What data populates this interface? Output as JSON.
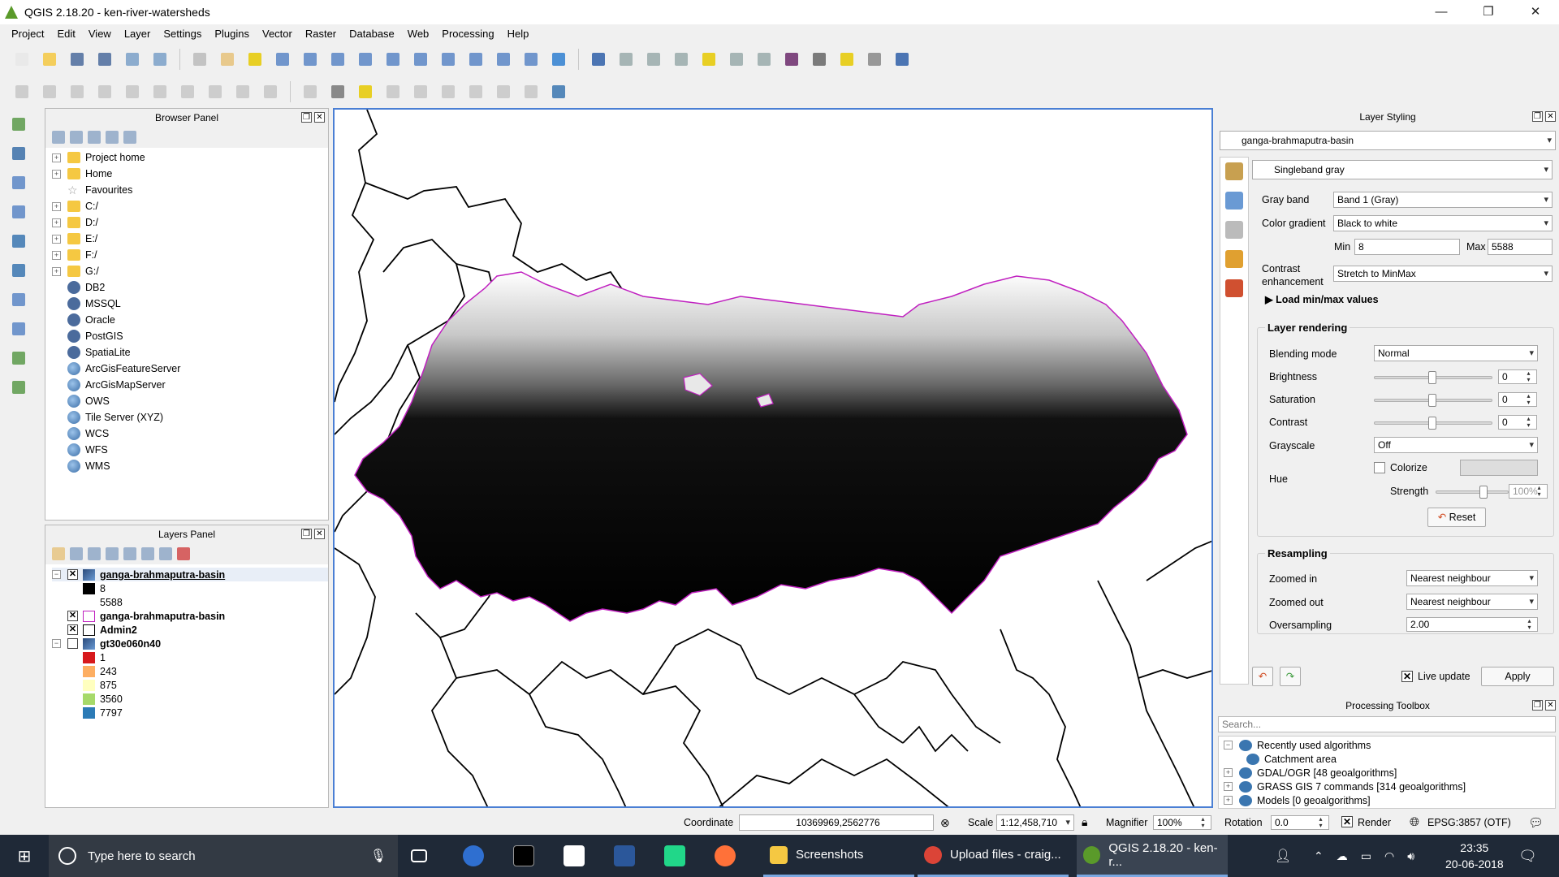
{
  "window": {
    "title": "QGIS 2.18.20 - ken-river-watersheds",
    "min": "—",
    "max": "❐",
    "close": "✕"
  },
  "menu": [
    "Project",
    "Edit",
    "View",
    "Layer",
    "Settings",
    "Plugins",
    "Vector",
    "Raster",
    "Database",
    "Web",
    "Processing",
    "Help"
  ],
  "browser": {
    "title": "Browser Panel",
    "items": [
      {
        "label": "Project home",
        "icon": "folder-icon",
        "exp": true
      },
      {
        "label": "Home",
        "icon": "folder-icon",
        "exp": true
      },
      {
        "label": "Favourites",
        "icon": "star-icon",
        "exp": false
      },
      {
        "label": "C:/",
        "icon": "folder-icon",
        "exp": true
      },
      {
        "label": "D:/",
        "icon": "folder-icon",
        "exp": true
      },
      {
        "label": "E:/",
        "icon": "folder-icon",
        "exp": true
      },
      {
        "label": "F:/",
        "icon": "folder-icon",
        "exp": true
      },
      {
        "label": "G:/",
        "icon": "folder-icon",
        "exp": true
      },
      {
        "label": "DB2",
        "icon": "db2-icon",
        "exp": false
      },
      {
        "label": "MSSQL",
        "icon": "mssql-icon",
        "exp": false
      },
      {
        "label": "Oracle",
        "icon": "oracle-icon",
        "exp": false
      },
      {
        "label": "PostGIS",
        "icon": "postgis-icon",
        "exp": false
      },
      {
        "label": "SpatiaLite",
        "icon": "spatialite-icon",
        "exp": false
      },
      {
        "label": "ArcGisFeatureServer",
        "icon": "globe-icon",
        "exp": false
      },
      {
        "label": "ArcGisMapServer",
        "icon": "globe-icon",
        "exp": false
      },
      {
        "label": "OWS",
        "icon": "globe-icon",
        "exp": false
      },
      {
        "label": "Tile Server (XYZ)",
        "icon": "globe-icon",
        "exp": false
      },
      {
        "label": "WCS",
        "icon": "globe-icon",
        "exp": false
      },
      {
        "label": "WFS",
        "icon": "globe-icon",
        "exp": false
      },
      {
        "label": "WMS",
        "icon": "globe-icon",
        "exp": false
      }
    ]
  },
  "layers": {
    "title": "Layers Panel",
    "l1": {
      "name": "ganga-brahmaputra-basin",
      "min": "8",
      "max": "5588"
    },
    "l2": {
      "name": "ganga-brahmaputra-basin"
    },
    "l3": {
      "name": "Admin2"
    },
    "l4": {
      "name": "gt30e060n40",
      "classes": [
        {
          "label": "1",
          "color": "#d7191c"
        },
        {
          "label": "243",
          "color": "#fdae61"
        },
        {
          "label": "875",
          "color": "#ffffbf"
        },
        {
          "label": "3560",
          "color": "#a6d96a"
        },
        {
          "label": "7797",
          "color": "#2c7bb6"
        }
      ]
    }
  },
  "styling": {
    "title": "Layer Styling",
    "layer": "ganga-brahmaputra-basin",
    "renderer": "Singleband gray",
    "gray_band_label": "Gray band",
    "gray_band": "Band 1 (Gray)",
    "gradient_label": "Color gradient",
    "gradient": "Black to white",
    "min_label": "Min",
    "min": "8",
    "max_label": "Max",
    "max": "5588",
    "contrast_label": "Contrast enhancement",
    "contrast": "Stretch to MinMax",
    "load_minmax": "Load min/max values",
    "rendering_title": "Layer rendering",
    "blending_label": "Blending mode",
    "blending": "Normal",
    "brightness_label": "Brightness",
    "brightness": "0",
    "saturation_label": "Saturation",
    "saturation": "0",
    "contrast2_label": "Contrast",
    "contrast2": "0",
    "grayscale_label": "Grayscale",
    "grayscale": "Off",
    "hue_label": "Hue",
    "colorize_label": "Colorize",
    "strength_label": "Strength",
    "strength": "100%",
    "reset": "Reset",
    "resampling_title": "Resampling",
    "zin_label": "Zoomed in",
    "zin": "Nearest neighbour",
    "zout_label": "Zoomed out",
    "zout": "Nearest neighbour",
    "over_label": "Oversampling",
    "over": "2.00",
    "live_update": "Live update",
    "apply": "Apply"
  },
  "processing": {
    "title": "Processing Toolbox",
    "search_placeholder": "Search...",
    "items": [
      {
        "label": "Recently used algorithms",
        "indent": 0
      },
      {
        "label": "Catchment area",
        "indent": 1
      },
      {
        "label": "GDAL/OGR [48 geoalgorithms]",
        "indent": 0
      },
      {
        "label": "GRASS GIS 7 commands [314 geoalgorithms]",
        "indent": 0
      },
      {
        "label": "Models [0 geoalgorithms]",
        "indent": 0
      }
    ]
  },
  "status": {
    "coord_label": "Coordinate",
    "coord": "10369969,2562776",
    "scale_label": "Scale",
    "scale": "1:12,458,710",
    "mag_label": "Magnifier",
    "mag": "100%",
    "rot_label": "Rotation",
    "rot": "0.0",
    "render_label": "Render",
    "crs": "EPSG:3857 (OTF)"
  },
  "taskbar": {
    "search": "Type here to search",
    "apps": [
      {
        "label": "Screenshots",
        "icon": "folder-icon"
      },
      {
        "label": "Upload files - craig...",
        "icon": "chrome-icon"
      },
      {
        "label": "QGIS 2.18.20 - ken-r...",
        "icon": "qgis-icon"
      }
    ],
    "time": "23:35",
    "date": "20-06-2018"
  }
}
